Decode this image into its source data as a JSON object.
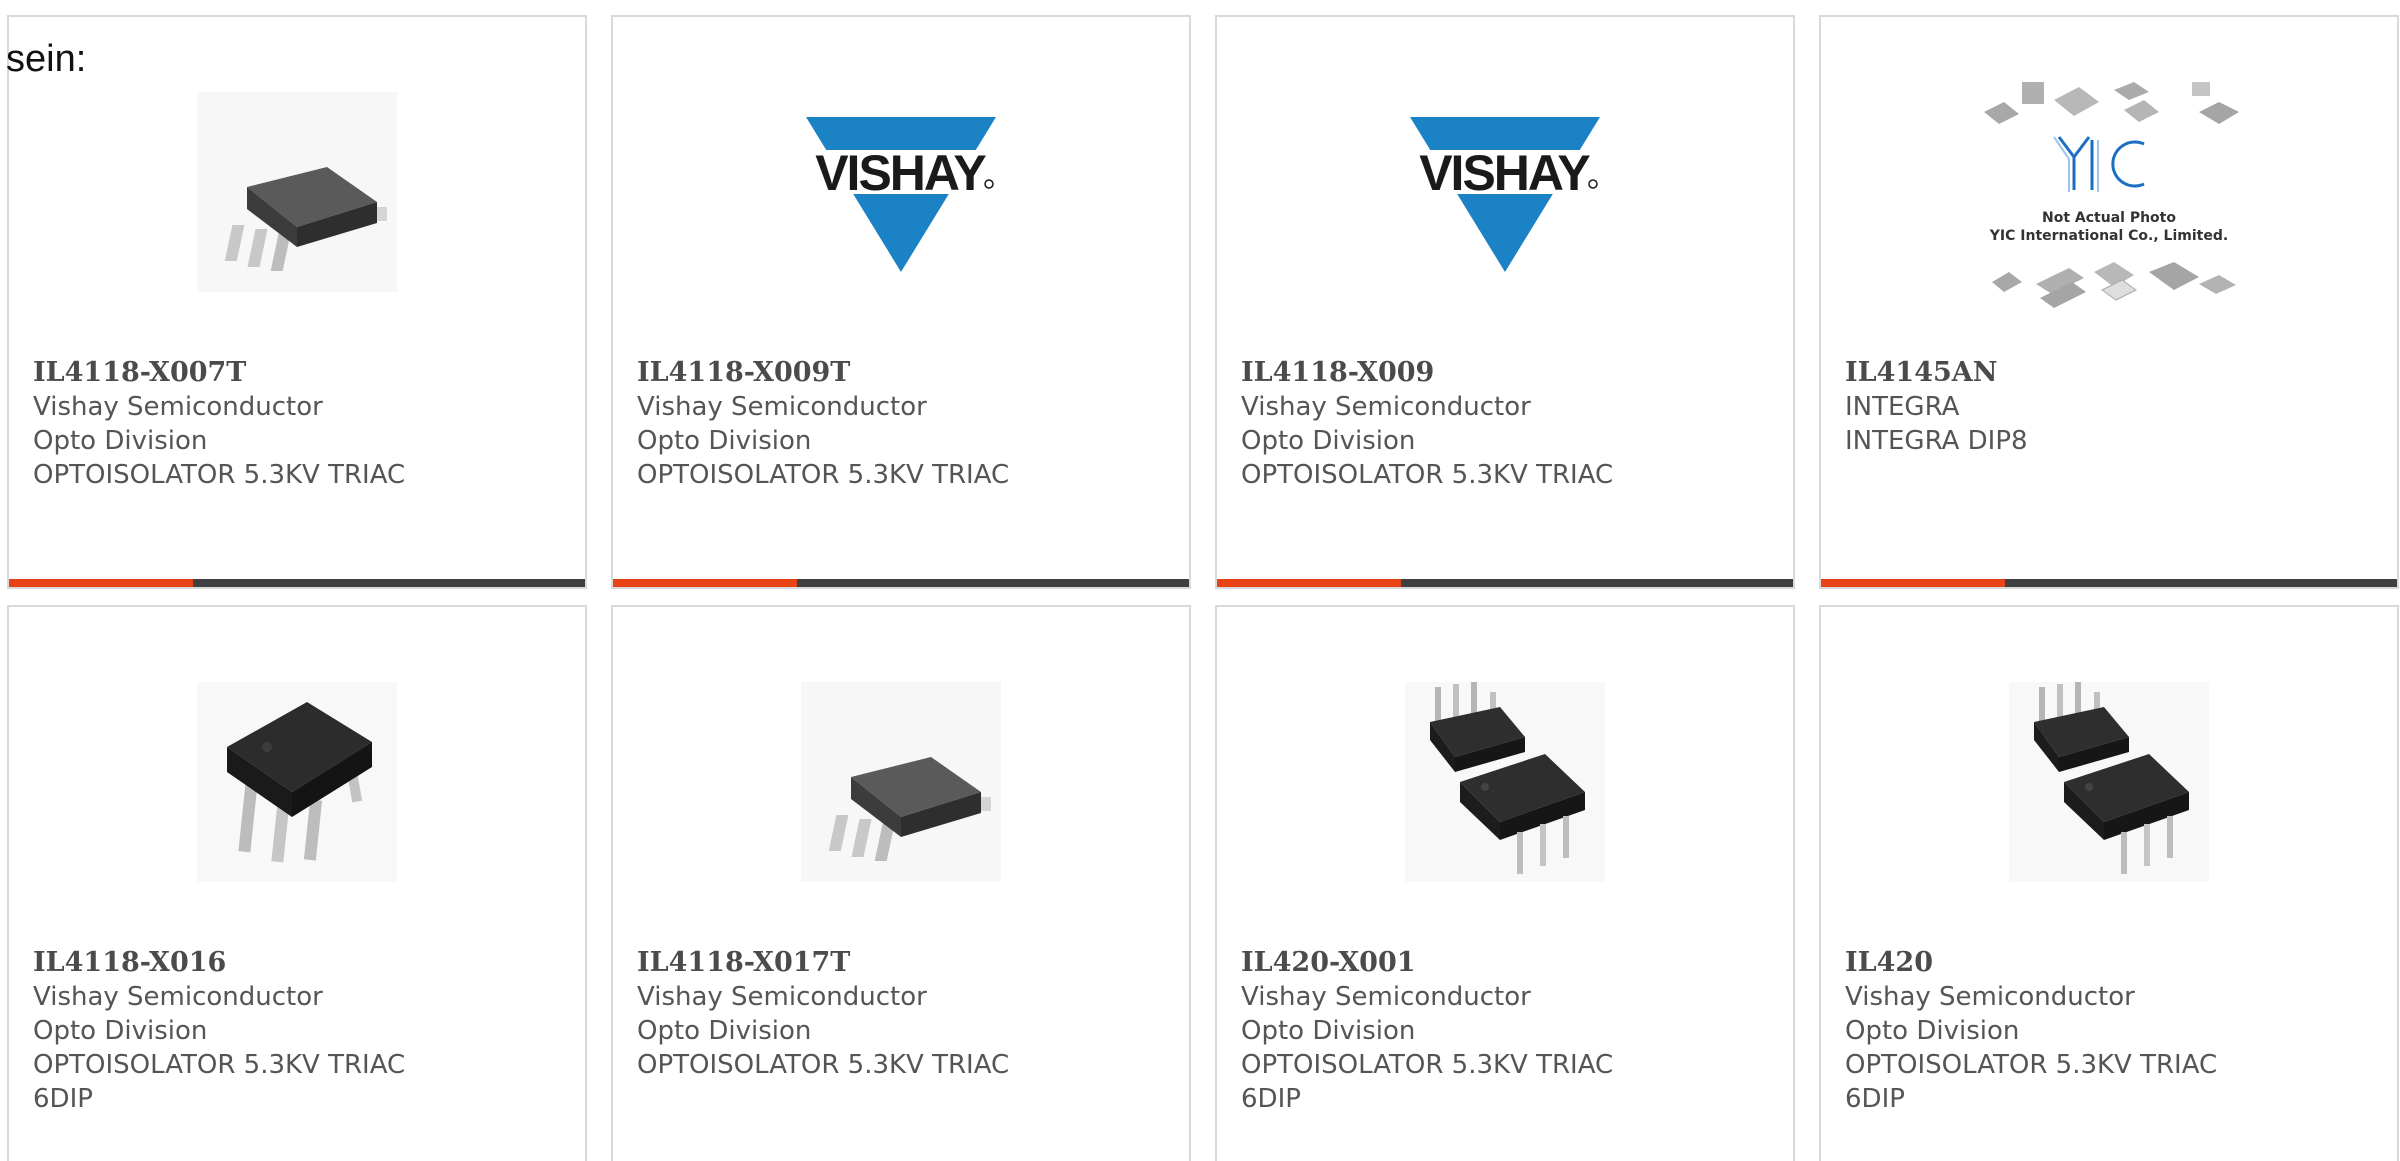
{
  "intro_text": "sein:",
  "colors": {
    "accent": "#e84314",
    "bar": "#404040",
    "border": "#d9d9d9",
    "vishay_blue": "#1b82c5"
  },
  "products": [
    {
      "part_number": "IL4118-X007T",
      "manufacturer": "Vishay Semiconductor Opto Division",
      "description": "OPTOISOLATOR 5.3KV TRIAC",
      "image": "smd-chip-image"
    },
    {
      "part_number": "IL4118-X009T",
      "manufacturer": "Vishay Semiconductor Opto Division",
      "description": "OPTOISOLATOR 5.3KV TRIAC",
      "image": "vishay-logo"
    },
    {
      "part_number": "IL4118-X009",
      "manufacturer": "Vishay Semiconductor Opto Division",
      "description": "OPTOISOLATOR 5.3KV TRIAC",
      "image": "vishay-logo"
    },
    {
      "part_number": "IL4145AN",
      "manufacturer": "INTEGRA",
      "description": "INTEGRA DIP8",
      "image": "yic-placeholder",
      "image_caption_1": "Not Actual Photo",
      "image_caption_2": "YIC International Co., Limited."
    },
    {
      "part_number": "IL4118-X016",
      "manufacturer": "Vishay Semiconductor Opto Division",
      "description": "OPTOISOLATOR 5.3KV TRIAC\n6DIP",
      "image": "dip-chip-image"
    },
    {
      "part_number": "IL4118-X017T",
      "manufacturer": "Vishay Semiconductor Opto Division",
      "description": "OPTOISOLATOR 5.3KV TRIAC",
      "image": "smd-chip-image"
    },
    {
      "part_number": "IL420-X001",
      "manufacturer": "Vishay Semiconductor Opto Division",
      "description": "OPTOISOLATOR 5.3KV TRIAC\n6DIP",
      "image": "dual-dip-chip-image"
    },
    {
      "part_number": "IL420",
      "manufacturer": "Vishay Semiconductor Opto Division",
      "description": "OPTOISOLATOR 5.3KV TRIAC\n6DIP",
      "image": "dual-dip-chip-image"
    }
  ]
}
